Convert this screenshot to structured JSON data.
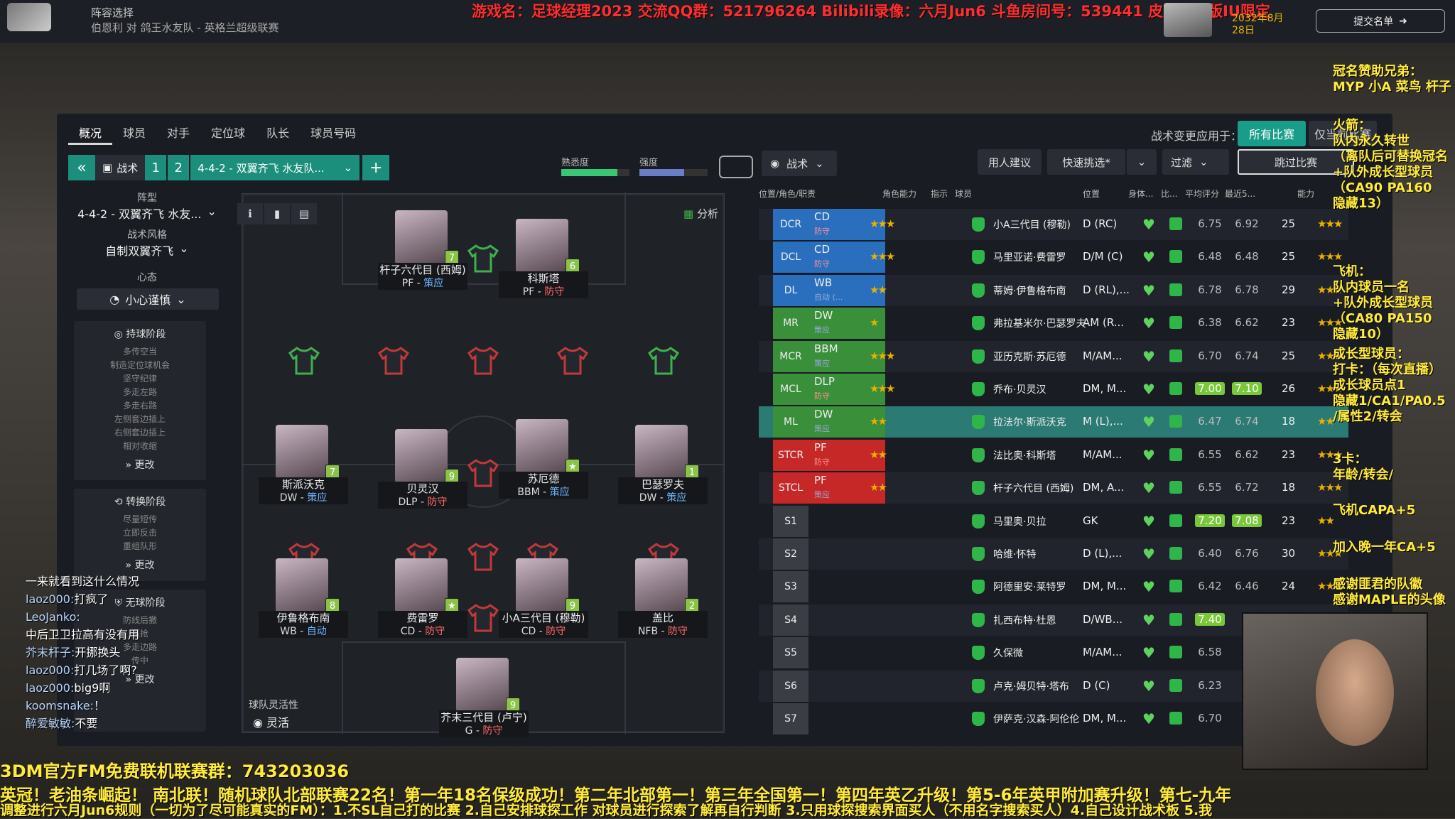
{
  "header": {
    "title": "阵容选择",
    "subtitle": "伯恩利 对 鸽王水友队 - 英格兰超级联赛",
    "date": "2032年8月28日",
    "submit_label": "提交名单"
  },
  "stream_overlay": {
    "top_banner": "游戏名：足球经理2023 交流QQ群：521796264 Bilibili录像：六月Jun6 斗鱼房间号：539441 皮肤：韩版IU限定",
    "side_notes": [
      "冠名赞助兄弟：",
      "MYP 小A 菜鸟 杆子",
      "火箭：",
      "队内永久转世",
      "（离队后可替换冠名",
      "+队外成长型球员",
      "（CA90 PA160",
      "隐藏13）",
      "飞机：",
      "队内球员一名",
      "+队外成长型球员",
      "（CA80 PA150",
      "隐藏10）",
      "成长型球员：",
      "打卡：（每次直播）",
      "成长球员点1",
      "隐藏1/CA1/PA0.5",
      "/属性2/转会",
      "3卡：",
      "年龄/转会/",
      "飞机CAPA+5",
      "加入晚一年CA+5",
      "感谢匪君的队徽",
      "感谢MAPLE的头像"
    ],
    "bottom_line1": "3DM官方FM免费联机联赛群：743203036",
    "bottom_line2": "英冠！老油条崛起！        南北联！随机球队北部联赛22名！第一年18名保级成功！第二年北部第一！第三年全国第一！第四年英乙升级！第5-6年英甲附加赛升级！第七-九年",
    "bottom_line3": "调整进行六月Jun6规则（一切为了尽可能真实的FM）：1.不SL自己打的比赛 2.自己安排球探工作 对球员进行探索了解再自行判断 3.只用球探搜索界面买人（不用名字搜索买人）4.自己设计战术板 5.我",
    "chat": [
      {
        "user": "",
        "msg": "一来就看到这什么情况"
      },
      {
        "user": "laoz000:",
        "msg": "打疯了"
      },
      {
        "user": "LeoJanko:",
        "msg": ""
      },
      {
        "user": "",
        "msg": "中后卫卫拉高有没有用"
      },
      {
        "user": "芥末杆子:",
        "msg": "开挪换头"
      },
      {
        "user": "laoz000:",
        "msg": "打几场了啊?"
      },
      {
        "user": "laoz000:",
        "msg": "big9啊"
      },
      {
        "user": "koomsnake:",
        "msg": "！"
      },
      {
        "user": "醉爱敏敏:",
        "msg": "不要"
      }
    ]
  },
  "tabs": [
    "概况",
    "球员",
    "对手",
    "定位球",
    "队长",
    "球员号码"
  ],
  "apply_to": {
    "label": "战术变更应用于：",
    "all": "所有比赛",
    "this": "仅当前比赛"
  },
  "tactic_bar": {
    "collapse": "«",
    "tactic_label": "战术",
    "slot1": "1",
    "slot2": "2",
    "formation_name": "4-4-2 - 双翼齐飞 水友队...",
    "add": "+",
    "familiarity_label": "熟悉度",
    "intensity_label": "强度",
    "familiarity": 0.82,
    "intensity": 0.66
  },
  "right_toolbar": {
    "tactic_dd": "战术",
    "advice": "用人建议",
    "quick_pick": "快速挑选*",
    "filter": "过滤",
    "skip": "跳过比赛"
  },
  "left": {
    "formation_label": "阵型",
    "formation": "4-4-2 - 双翼齐飞 水友...",
    "style_label": "战术风格",
    "style": "自制双翼齐飞",
    "mentality_label": "心态",
    "mentality": "小心谨慎",
    "in_possession": {
      "title": "持球阶段",
      "items": [
        "多传空当",
        "制造定位球机会",
        "坚守纪律",
        "多走左路",
        "多走右路",
        "左侧套边插上",
        "右侧套边插上",
        "相对收缩"
      ],
      "more": "更改"
    },
    "transition": {
      "title": "转换阶段",
      "items": [
        "尽量短传",
        "立即反击",
        "重组队形"
      ],
      "more": "更改"
    },
    "out_possession": {
      "title": "无球阶段",
      "items": [
        "防线后撤",
        "逼抢",
        "多走边路",
        "传中"
      ],
      "more": "更改"
    }
  },
  "pitch": {
    "analysis": "分析",
    "flex_label": "球队灵活性",
    "flex_value": "灵活",
    "players": [
      {
        "name": "杆子六代目 (西姆)",
        "role": "PF - ",
        "duty": "策应",
        "badge": "7"
      },
      {
        "name": "科斯塔",
        "role": "PF - ",
        "duty": "防守",
        "badge": "6"
      },
      {
        "name": "斯派沃克",
        "role": "DW - ",
        "duty": "策应",
        "badge": "7"
      },
      {
        "name": "贝灵汉",
        "role": "DLP - ",
        "duty": "防守",
        "badge": "9"
      },
      {
        "name": "苏厄德",
        "role": "BBM - ",
        "duty": "策应",
        "badge": "★"
      },
      {
        "name": "巴瑟罗夫",
        "role": "DW - ",
        "duty": "策应",
        "badge": "1"
      },
      {
        "name": "伊鲁格布南",
        "role": "WB - ",
        "duty": "自动",
        "badge": "8"
      },
      {
        "name": "费雷罗",
        "role": "CD - ",
        "duty": "防守",
        "badge": "★"
      },
      {
        "name": "小A三代目 (穆勒)",
        "role": "CD - ",
        "duty": "防守",
        "badge": "9"
      },
      {
        "name": "盖比",
        "role": "NFB - ",
        "duty": "防守",
        "badge": "2"
      },
      {
        "name": "芥末三代目 (卢宁)",
        "role": "G - ",
        "duty": "防守",
        "badge": "9"
      }
    ]
  },
  "table": {
    "headers": [
      "位置/角色/职责",
      "角色能力",
      "指示",
      "球员",
      "位置",
      "身体...",
      "比...",
      "平均评分",
      "最近5...",
      "能力"
    ],
    "rows": [
      {
        "pos": "DCR",
        "role": "CD",
        "duty": "防守",
        "stars": "★★★",
        "name": "小A三代目 (穆勒)",
        "position": "D (RC)",
        "avg": "6.75",
        "recent": "6.92",
        "age": "25",
        "ability": "★★★",
        "color": "#2a6fbd"
      },
      {
        "pos": "DCL",
        "role": "CD",
        "duty": "防守",
        "stars": "★★★",
        "name": "马里亚诺·费雷罗",
        "position": "D/M (C)",
        "avg": "6.48",
        "recent": "6.48",
        "age": "25",
        "ability": "★★★",
        "color": "#2a6fbd"
      },
      {
        "pos": "DL",
        "role": "WB",
        "duty": "自动 (...",
        "stars": "★★",
        "name": "蒂姆·伊鲁格布南",
        "position": "D (RL),...",
        "avg": "6.78",
        "recent": "6.78",
        "age": "29",
        "ability": "★★★",
        "color": "#2a6fbd"
      },
      {
        "pos": "MR",
        "role": "DW",
        "duty": "策应",
        "stars": "★",
        "name": "弗拉基米尔·巴瑟罗夫",
        "position": "AM (R...",
        "avg": "6.38",
        "recent": "6.62",
        "age": "23",
        "ability": "★★★",
        "color": "#3a8f3a"
      },
      {
        "pos": "MCR",
        "role": "BBM",
        "duty": "策应",
        "stars": "★★★",
        "name": "亚历克斯·苏厄德",
        "position": "M/AM...",
        "avg": "6.70",
        "recent": "6.74",
        "age": "25",
        "ability": "★★★",
        "color": "#3a8f3a"
      },
      {
        "pos": "MCL",
        "role": "DLP",
        "duty": "防守",
        "stars": "★★★",
        "name": "乔布·贝灵汉",
        "position": "DM, M...",
        "avg": "7.00",
        "recent": "7.10",
        "age": "26",
        "ability": "★★★",
        "color": "#3a8f3a"
      },
      {
        "pos": "ML",
        "role": "DW",
        "duty": "策应",
        "stars": "★★",
        "name": "拉法尔·斯派沃克",
        "position": "M (L),...",
        "avg": "6.47",
        "recent": "6.74",
        "age": "18",
        "ability": "★★",
        "color": "#3a8f3a"
      },
      {
        "pos": "STCR",
        "role": "PF",
        "duty": "防守",
        "stars": "★★",
        "name": "法比奥·科斯塔",
        "position": "M/AM...",
        "avg": "6.55",
        "recent": "6.62",
        "age": "23",
        "ability": "★★★",
        "color": "#c62828"
      },
      {
        "pos": "STCL",
        "role": "PF",
        "duty": "策应",
        "stars": "★★",
        "name": "杆子六代目 (西姆)",
        "position": "DM, A...",
        "avg": "6.55",
        "recent": "6.72",
        "age": "18",
        "ability": "★★★",
        "color": "#c62828"
      },
      {
        "pos": "S1",
        "role": "",
        "duty": "",
        "stars": "",
        "name": "马里奥·贝拉",
        "position": "GK",
        "avg": "7.20",
        "recent": "7.08",
        "age": "23",
        "ability": "★★",
        "color": ""
      },
      {
        "pos": "S2",
        "role": "",
        "duty": "",
        "stars": "",
        "name": "哈维·怀特",
        "position": "D (L),...",
        "avg": "6.40",
        "recent": "6.76",
        "age": "30",
        "ability": "★★★",
        "color": ""
      },
      {
        "pos": "S3",
        "role": "",
        "duty": "",
        "stars": "",
        "name": "阿德里安·莱特罗",
        "position": "DM, M...",
        "avg": "6.42",
        "recent": "6.46",
        "age": "24",
        "ability": "★★★",
        "color": ""
      },
      {
        "pos": "S4",
        "role": "",
        "duty": "",
        "stars": "",
        "name": "扎西布特·杜恩",
        "position": "D/WB...",
        "avg": "7.40",
        "recent": "",
        "age": "",
        "ability": "",
        "color": ""
      },
      {
        "pos": "S5",
        "role": "",
        "duty": "",
        "stars": "",
        "name": "久保微",
        "position": "M/AM...",
        "avg": "6.58",
        "recent": "",
        "age": "",
        "ability": "",
        "color": ""
      },
      {
        "pos": "S6",
        "role": "",
        "duty": "",
        "stars": "",
        "name": "卢克·姆贝特·塔布",
        "position": "D (C)",
        "avg": "6.23",
        "recent": "",
        "age": "",
        "ability": "",
        "color": ""
      },
      {
        "pos": "S7",
        "role": "",
        "duty": "",
        "stars": "",
        "name": "伊萨克·汉森-阿伦伦",
        "position": "DM, M...",
        "avg": "6.70",
        "recent": "",
        "age": "",
        "ability": "",
        "color": ""
      }
    ]
  }
}
